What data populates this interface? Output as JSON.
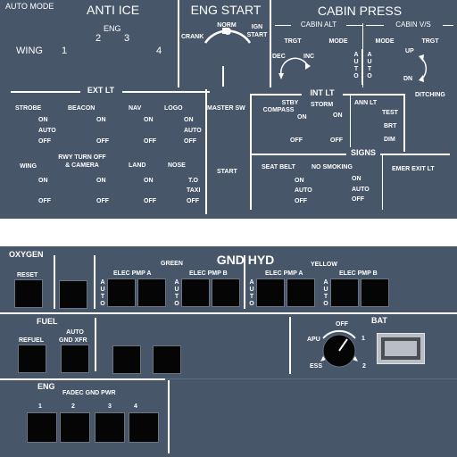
{
  "anti_ice": {
    "auto_mode": "AUTO MODE",
    "title": "ANTI ICE",
    "eng": "ENG",
    "two": "2",
    "three": "3",
    "wing": "WING",
    "one": "1",
    "four": "4"
  },
  "eng_start": {
    "title": "ENG START",
    "norm": "NORM",
    "crank": "CRANK",
    "ign": "IGN",
    "start": "START"
  },
  "cabin_press": {
    "title": "CABIN PRESS",
    "cabin_alt": "CABIN ALT",
    "cabin_vs": "CABIN V/S",
    "trgt": "TRGT",
    "mode": "MODE",
    "dec": "DEC",
    "inc": "INC",
    "auto": "AUTO",
    "up": "UP",
    "dn": "DN"
  },
  "ext_lt": {
    "title": "EXT LT",
    "strobe": "STROBE",
    "beacon": "BEACON",
    "nav": "NAV",
    "logo": "LOGO",
    "master_sw": "MASTER SW",
    "on": "ON",
    "auto": "AUTO",
    "off": "OFF",
    "wing": "WING",
    "rwy_turn_off": "RWY TURN OFF",
    "and_camera": "& CAMERA",
    "land": "LAND",
    "nose": "NOSE",
    "to": "T.O",
    "taxi": "TAXI",
    "start": "START"
  },
  "int_lt": {
    "title": "INT LT",
    "stby": "STBY",
    "compass": "COMPASS",
    "storm": "STORM",
    "ann_lt": "ANN LT",
    "test": "TEST",
    "brt": "BRT",
    "dim": "DIM",
    "ditching": "DITCHING",
    "on": "ON",
    "off": "OFF"
  },
  "signs": {
    "title": "SIGNS",
    "seat_belt": "SEAT BELT",
    "no_smoking": "NO SMOKING",
    "emer_exit_lt": "EMER EXIT LT",
    "on": "ON",
    "auto": "AUTO",
    "off": "OFF"
  },
  "oxygen": {
    "title": "OXYGEN",
    "reset": "RESET"
  },
  "gnd_hyd": {
    "title": "GND HYD",
    "green": "GREEN",
    "yellow": "YELLOW",
    "elec_pmp_a": "ELEC PMP A",
    "elec_pmp_b": "ELEC PMP B",
    "auto": "AUTO"
  },
  "fuel": {
    "title": "FUEL",
    "refuel": "REFUEL",
    "auto": "AUTO",
    "gnd_xfr": "GND XFR"
  },
  "bat": {
    "title": "BAT",
    "off": "OFF",
    "apu": "APU",
    "one": "1",
    "ess": "ESS",
    "two": "2"
  },
  "eng_lower": {
    "title": "ENG",
    "fadec_gnd_pwr": "FADEC GND PWR",
    "one": "1",
    "two": "2",
    "three": "3",
    "four": "4"
  },
  "colors": {
    "panel": "#48566a",
    "text": "#ffffff",
    "button": "#050505"
  }
}
